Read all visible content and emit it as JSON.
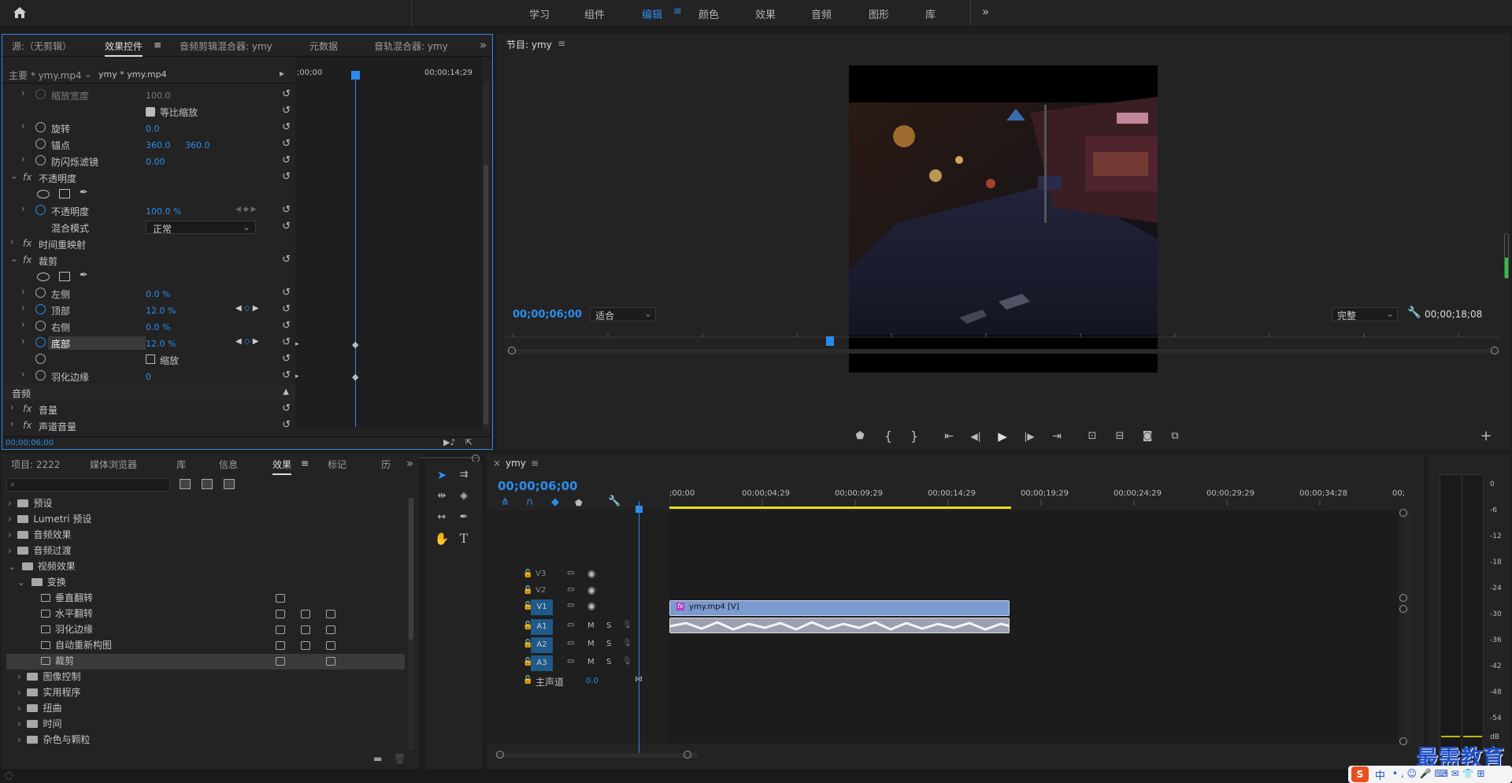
{
  "workspace": {
    "tabs": [
      "学习",
      "组件",
      "编辑",
      "颜色",
      "效果",
      "音频",
      "图形",
      "库"
    ],
    "active": "编辑"
  },
  "effect_controls": {
    "tabs": [
      "源:（无剪辑）",
      "效果控件",
      "音频剪辑混合器: ymy",
      "元数据",
      "音轨混合器: ymy"
    ],
    "master": "主要 * ymy.mp4",
    "seq": "ymy * ymy.mp4",
    "ruler_start": ";00;00",
    "ruler_end": "00;00;14;29",
    "timecode": "00;00;06;00",
    "rows": {
      "scale_width": {
        "label": "缩放宽度",
        "value": "100.0"
      },
      "uniform": "等比缩放",
      "rotation": {
        "label": "旋转",
        "value": "0.0"
      },
      "anchor": {
        "label": "锚点",
        "v1": "360.0",
        "v2": "360.0"
      },
      "flicker": {
        "label": "防闪烁滤镜",
        "value": "0.00"
      },
      "opacity_fx": "不透明度",
      "opacity": {
        "label": "不透明度",
        "value": "100.0 %"
      },
      "blend": {
        "label": "混合模式",
        "value": "正常"
      },
      "remap": "时间重映射",
      "crop_fx": "裁剪",
      "left": {
        "label": "左侧",
        "value": "0.0 %"
      },
      "top": {
        "label": "顶部",
        "value": "12.0 %"
      },
      "right": {
        "label": "右侧",
        "value": "0.0 %"
      },
      "bottom": {
        "label": "底部",
        "value": "12.0 %"
      },
      "zoom": "缩放",
      "feather": {
        "label": "羽化边缘",
        "value": "0"
      },
      "audio": "音频",
      "volume": "音量",
      "channel_volume": "声道音量"
    }
  },
  "program": {
    "title": "节目: ymy",
    "timecode": "00;00;06;00",
    "fit": "适合",
    "quality": "完整",
    "duration": "00;00;18;08"
  },
  "project": {
    "tabs": [
      "项目: 2222",
      "媒体浏览器",
      "库",
      "信息",
      "效果",
      "标记",
      "历"
    ],
    "search_placeholder": "",
    "tree": [
      "预设",
      "Lumetri 预设",
      "音频效果",
      "音频过渡",
      "视频效果",
      "变换",
      "垂直翻转",
      "水平翻转",
      "羽化边缘",
      "自动重新构图",
      "裁剪",
      "图像控制",
      "实用程序",
      "扭曲",
      "时间",
      "杂色与颗粒"
    ]
  },
  "timeline": {
    "title": "ymy",
    "timecode": "00;00;06;00",
    "ruler": [
      ";00;00",
      "00;00;04;29",
      "00;00;09;29",
      "00;00;14;29",
      "00;00;19;29",
      "00;00;24;29",
      "00;00;29;29",
      "00;00;34;28",
      "00;"
    ],
    "tracks": [
      "V3",
      "V2",
      "V1",
      "A1",
      "A2",
      "A3"
    ],
    "master": "主声道",
    "master_val": "0.0",
    "clip": "ymy.mp4 [V]",
    "m": "M",
    "s": "S"
  },
  "meter": {
    "scale": [
      "0",
      "-6",
      "-12",
      "-18",
      "-24",
      "-30",
      "-36",
      "-42",
      "-48",
      "-54",
      "dB"
    ]
  },
  "watermark": "最需教育",
  "ime": "中"
}
